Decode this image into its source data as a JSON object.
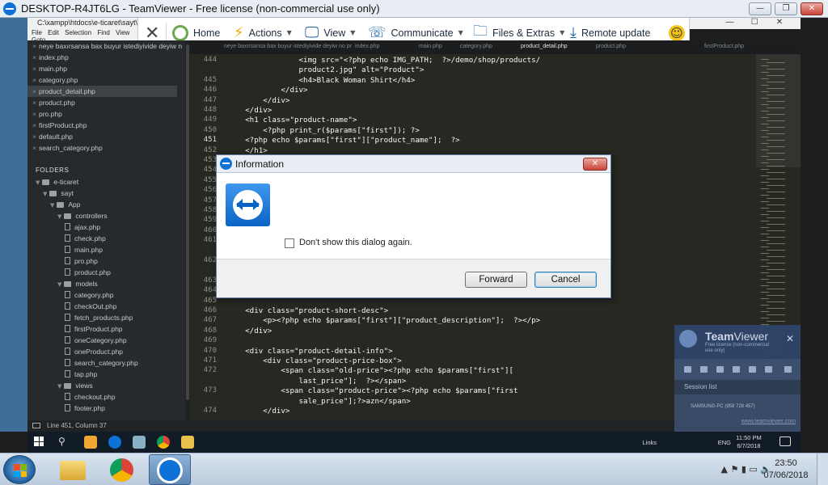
{
  "teamviewer": {
    "window_title": "DESKTOP-R4JT6LG - TeamViewer - Free license (non-commercial use only)",
    "min_glyph": "—",
    "max_glyph": "❐",
    "close_glyph": "✕",
    "toolbar": {
      "close_glyph": "✕",
      "home": "Home",
      "actions": "Actions",
      "view": "View",
      "communicate": "Communicate",
      "files": "Files & Extras",
      "remote_update": "Remote update",
      "feedback_glyph": "☺"
    }
  },
  "remote_window": {
    "path": "C:\\xampp\\htdocs\\e-ticaret\\sayt\\App\\",
    "menu": [
      "File",
      "Edit",
      "Selection",
      "Find",
      "View",
      "Goto"
    ],
    "ctrl_min": "—",
    "ctrl_max": "☐",
    "ctrl_close": "✕"
  },
  "sidebar": {
    "open_files": [
      {
        "name": "neye baxırsansa bax buyur istediyivide deyiw no problem",
        "active": false
      },
      {
        "name": "index.php",
        "active": false
      },
      {
        "name": "main.php",
        "active": false
      },
      {
        "name": "category.php",
        "active": false
      },
      {
        "name": "product_detail.php",
        "active": true
      },
      {
        "name": "product.php",
        "active": false
      },
      {
        "name": "pro.php",
        "active": false
      },
      {
        "name": "firstProduct.php",
        "active": false
      },
      {
        "name": "default.php",
        "active": false
      },
      {
        "name": "search_category.php",
        "active": false
      }
    ],
    "folders_label": "FOLDERS",
    "tree": [
      {
        "name": "e-ticaret",
        "type": "folder",
        "depth": 0
      },
      {
        "name": "sayt",
        "type": "folder",
        "depth": 1
      },
      {
        "name": "App",
        "type": "folder",
        "depth": 2
      },
      {
        "name": "controllers",
        "type": "folder",
        "depth": 3
      },
      {
        "name": "ajax.php",
        "type": "file",
        "depth": 4
      },
      {
        "name": "check.php",
        "type": "file",
        "depth": 4
      },
      {
        "name": "main.php",
        "type": "file",
        "depth": 4
      },
      {
        "name": "pro.php",
        "type": "file",
        "depth": 4
      },
      {
        "name": "product.php",
        "type": "file",
        "depth": 4
      },
      {
        "name": "models",
        "type": "folder",
        "depth": 3
      },
      {
        "name": "category.php",
        "type": "file",
        "depth": 4
      },
      {
        "name": "checkOut.php",
        "type": "file",
        "depth": 4
      },
      {
        "name": "fetch_products.php",
        "type": "file",
        "depth": 4
      },
      {
        "name": "firstProduct.php",
        "type": "file",
        "depth": 4
      },
      {
        "name": "oneCategory.php",
        "type": "file",
        "depth": 4
      },
      {
        "name": "oneProduct.php",
        "type": "file",
        "depth": 4
      },
      {
        "name": "search_category.php",
        "type": "file",
        "depth": 4
      },
      {
        "name": "tap.php",
        "type": "file",
        "depth": 4
      },
      {
        "name": "views",
        "type": "folder",
        "depth": 3
      },
      {
        "name": "checkout.php",
        "type": "file",
        "depth": 4
      },
      {
        "name": "footer.php",
        "type": "file",
        "depth": 4
      }
    ]
  },
  "tabs": [
    {
      "label": "neye baxırsansa bax buyur istediyivide deyiw no pr",
      "active": false
    },
    {
      "label": "index.php",
      "active": false
    },
    {
      "label": "main.php",
      "active": false
    },
    {
      "label": "category.php",
      "active": false
    },
    {
      "label": "product_detail.php",
      "active": true
    },
    {
      "label": "product.php",
      "active": false
    },
    {
      "label": "firstProduct.php",
      "active": false
    }
  ],
  "code": {
    "current_line": "451",
    "lines": [
      {
        "n": "444",
        "text": "                <img src=\"<?php echo IMG_PATH;  ?>/demo/shop/products/"
      },
      {
        "n": "",
        "text": "                product2.jpg\" alt=\"Product\">"
      },
      {
        "n": "445",
        "text": "                <h4>Black Woman Shirt</h4>"
      },
      {
        "n": "446",
        "text": "            </div>"
      },
      {
        "n": "447",
        "text": "        </div>"
      },
      {
        "n": "448",
        "text": "    </div>"
      },
      {
        "n": "449",
        "text": "    <h1 class=\"product-name\">"
      },
      {
        "n": "450",
        "text": "        <?php print_r($params[\"first\"]); ?>"
      },
      {
        "n": "451",
        "text": "    <?php echo $params[\"first\"][\"product_name\"];  ?>"
      },
      {
        "n": "452",
        "text": "    </h1>"
      },
      {
        "n": "453",
        "text": ""
      },
      {
        "n": "454",
        "text": ""
      },
      {
        "n": "455",
        "text": ""
      },
      {
        "n": "456",
        "text": ""
      },
      {
        "n": "457",
        "text": "                                                      th:60%\"></div>"
      },
      {
        "n": "458",
        "text": ""
      },
      {
        "n": "459",
        "text": ""
      },
      {
        "n": "460",
        "text": ""
      },
      {
        "n": "461",
        "text": "                                                      rel=\"nofollow\"> <span"
      },
      {
        "n": "",
        "text": "                                                      view</a> |"
      },
      {
        "n": "462",
        "text": "                                                      nk\" rel=\"nofollow\">Add a"
      },
      {
        "n": "",
        "text": ""
      },
      {
        "n": "463",
        "text": ""
      },
      {
        "n": "464",
        "text": ""
      },
      {
        "n": "465",
        "text": ""
      },
      {
        "n": "466",
        "text": "    <div class=\"product-short-desc\">"
      },
      {
        "n": "467",
        "text": "        <p><?php echo $params[\"first\"][\"product_description\"];  ?></p>"
      },
      {
        "n": "468",
        "text": "    </div>"
      },
      {
        "n": "469",
        "text": ""
      },
      {
        "n": "470",
        "text": "    <div class=\"product-detail-info\">"
      },
      {
        "n": "471",
        "text": "        <div class=\"product-price-box\">"
      },
      {
        "n": "472",
        "text": "            <span class=\"old-price\"><?php echo $params[\"first\"]["
      },
      {
        "n": "",
        "text": "                last_price\"];  ?></span>"
      },
      {
        "n": "473",
        "text": "            <span class=\"product-price\"><?php echo $params[\"first"
      },
      {
        "n": "",
        "text": "                sale_price\"];?>azn</span>"
      },
      {
        "n": "474",
        "text": "        </div>"
      }
    ]
  },
  "statusbar": {
    "text": "Line 451, Column 37"
  },
  "remote_taskbar": {
    "links": "Links",
    "lang": "ENG",
    "time": "11:50 PM",
    "date": "6/7/2018"
  },
  "dialog": {
    "title": "Information",
    "close_glyph": "✕",
    "checkbox_label": "Don't show this dialog again.",
    "forward_label": "Forward",
    "cancel_label": "Cancel"
  },
  "session_panel": {
    "brand_a": "Team",
    "brand_b": "Viewer",
    "license": "Free license (non-commercial use only)",
    "close_glyph": "✕",
    "session_list": "Session list",
    "session_item": "SAMSUNG-PC (958 728 457)",
    "url": "www.teamviewer.com"
  },
  "taskbar": {
    "time": "23:50",
    "date": "07/06/2018"
  },
  "colors": {
    "teamviewer_blue": "#0e71d8",
    "editor_bg": "#272822",
    "sidebar_bg": "#262a2d"
  }
}
